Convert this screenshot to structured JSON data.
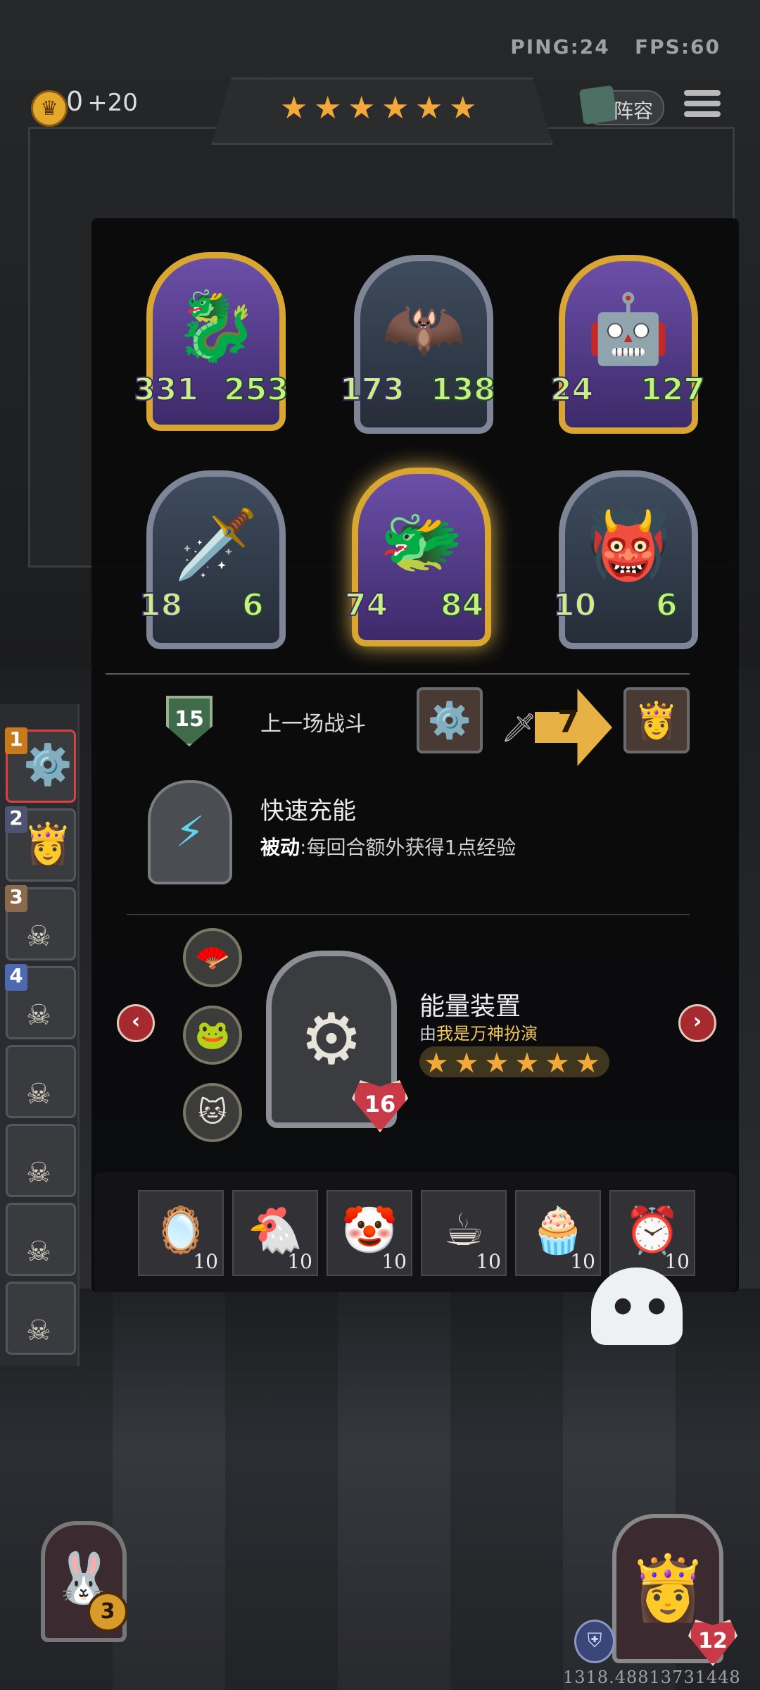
{
  "status": {
    "ping": "PING:24",
    "fps": "FPS:60",
    "coordinate": "1318.48813731448"
  },
  "gold": {
    "amount": "0",
    "income": "+20"
  },
  "header": {
    "stars": [
      "★",
      "★",
      "★",
      "★",
      "★",
      "★"
    ],
    "lineup_label": "阵容"
  },
  "board": {
    "top_row": [
      {
        "attack": "331",
        "health": "253",
        "frame": "gold",
        "art": "🐉"
      },
      {
        "attack": "173",
        "health": "138",
        "frame": "silver",
        "art": "🦇"
      },
      {
        "attack": "24",
        "health": "127",
        "frame": "gold",
        "art": "🤖"
      }
    ],
    "bottom_row": [
      {
        "attack": "18",
        "health": "6",
        "frame": "silver",
        "art": "🗡️"
      },
      {
        "attack": "74",
        "health": "84",
        "frame": "gold",
        "art": "🐲"
      },
      {
        "attack": "10",
        "health": "6",
        "frame": "silver",
        "art": "👹"
      }
    ]
  },
  "battle": {
    "round": "15",
    "label": "上一场战斗",
    "damage": "7"
  },
  "skill": {
    "name": "快速充能",
    "type": "被动",
    "description": ":每回合额外获得1点经验"
  },
  "relic": {
    "name": "能量装置",
    "by_prefix": "由",
    "by_name": "我是万神扮演",
    "level": "16",
    "stars": [
      "★",
      "★",
      "★",
      "★",
      "★",
      "★"
    ],
    "options": [
      "🪭",
      "🐸",
      "🐱"
    ]
  },
  "items": [
    {
      "icon": "🪞",
      "count": "10"
    },
    {
      "icon": "🐔",
      "count": "10"
    },
    {
      "icon": "🤡",
      "count": "10"
    },
    {
      "icon": "☕",
      "count": "10"
    },
    {
      "icon": "🧁",
      "count": "10"
    },
    {
      "icon": "⏰",
      "count": "10"
    }
  ],
  "sidebar": {
    "numbers": [
      "1",
      "2",
      "3",
      "4"
    ]
  },
  "player": {
    "left_level": "3",
    "right_health": "12"
  },
  "colors": {
    "accent_gold": "#f3a93a",
    "stat_green": "#c8f080",
    "badge_red": "#c93a48"
  }
}
